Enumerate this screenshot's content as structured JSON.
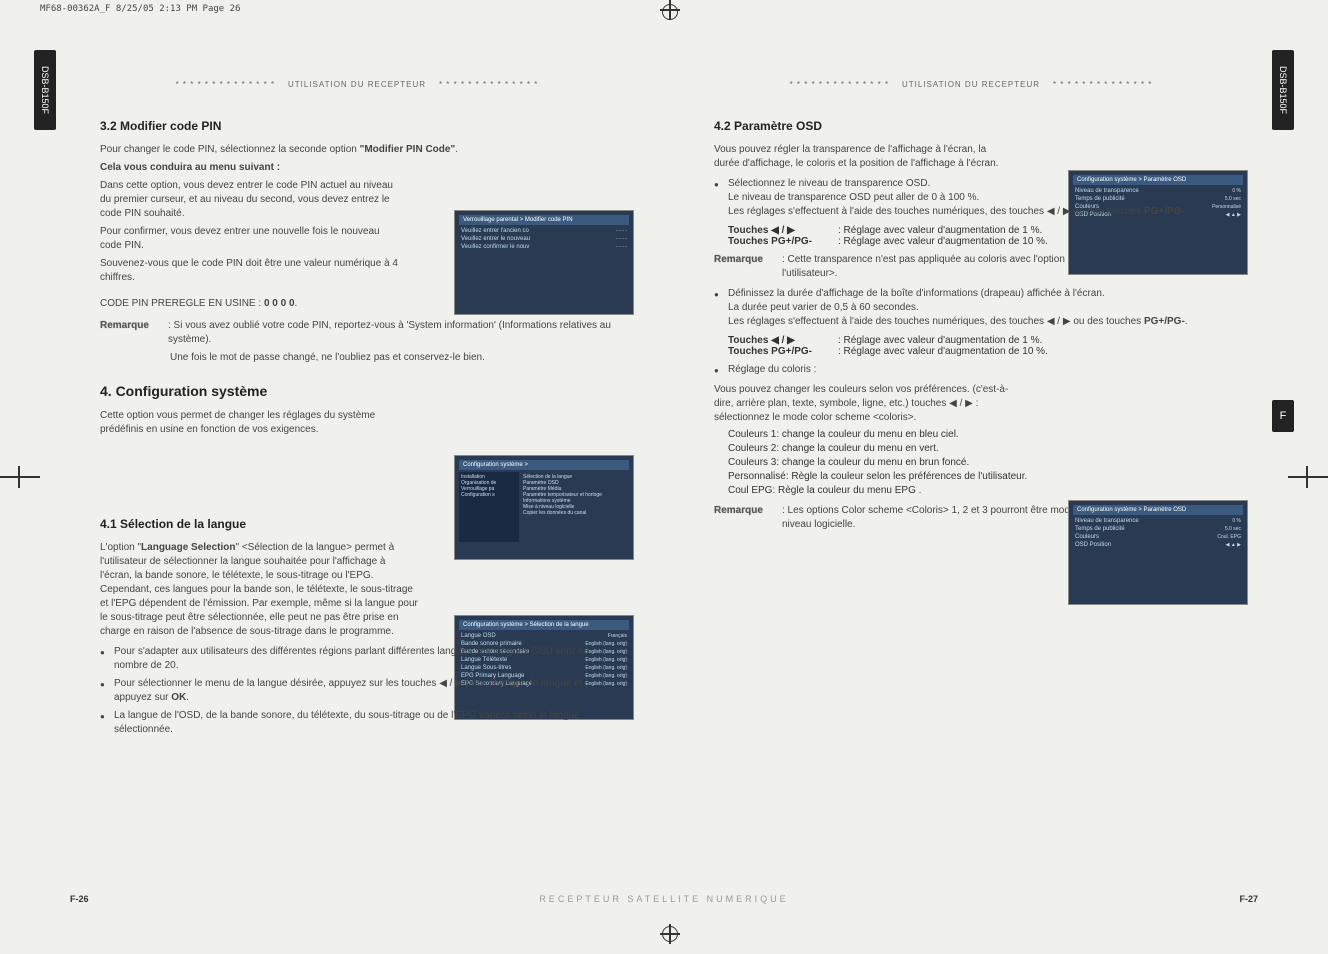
{
  "top_header": "MF68-00362A_F  8/25/05  2:13 PM  Page 26",
  "side_model": "DSB-B150F",
  "side_f": "F",
  "receiver_header_dots": "* * * * * * * * * * * * * *",
  "receiver_header_text": "UTILISATION DU RECEPTEUR",
  "left": {
    "h32": "3.2 Modifier code PIN",
    "p32_1": "Pour changer le code PIN, sélectionnez la seconde option ",
    "p32_1b": "\"Modifier PIN Code\"",
    "p32_1c": ".",
    "p32_sub": "Cela vous conduira au menu suivant :",
    "p32_2": "Dans cette option, vous devez entrer le code PIN actuel au niveau du premier curseur, et au niveau du second, vous devez entrez le code PIN souhaité.",
    "p32_3": "Pour confirmer, vous devez entrer une nouvelle fois le nouveau code PIN.",
    "p32_4": "Souvenez-vous que le code PIN doit être une valeur numérique à 4 chiffres.",
    "p32_5a": "CODE PIN PREREGLE EN USINE : ",
    "p32_5b": "0 0 0 0",
    "p32_5c": ".",
    "note_label": "Remarque",
    "note32_1": ": Si vous avez oublié votre code PIN, reportez-vous à 'System information' (Informations relatives au système).",
    "note32_2": "Une fois le mot de passe changé, ne l'oubliez pas et conservez-le bien.",
    "h4": "4. Configuration système",
    "p4_1": "Cette option vous permet de changer les réglages du système prédéfinis en usine en fonction de vos exigences.",
    "h41": "4.1 Sélection de la langue",
    "p41_1a": "L'option \"",
    "p41_1b": "Language Selection",
    "p41_1c": "\" <Sélection de la langue> permet à l'utilisateur de sélectionner la langue souhaitée pour l'affichage à l'écran, la bande sonore, le télétexte, le sous-titrage ou l'EPG. Cependant, ces langues pour la bande son, le télétexte, le sous-titrage et l'EPG dépendent de l'émission. Par exemple, même si la langue pour le sous-titrage peut être sélectionnée, elle peut ne pas être prise en charge en raison de l'absence de sous-titrage dans le programme.",
    "b41_1": "Pour s'adapter aux utilisateurs des différentes régions parlant différentes langues, les langues OSD sont au nombre de 20.",
    "b41_2a": "Pour sélectionner le menu de la langue désirée, appuyez sur les touches ◀ / ▶ pour changer de langue et appuyez sur ",
    "b41_2b": "OK",
    "b41_2c": ".",
    "b41_3": "La langue de l'OSD, de la bande sonore, du télétexte, du sous-titrage ou de l'EPG variera selon la langue sélectionnée.",
    "pn": "F-26"
  },
  "right": {
    "h42": "4.2 Paramètre OSD",
    "p42_1": "Vous pouvez régler la transparence de l'affichage à l'écran, la durée d'affichage, le coloris et la position de l'affichage à l'écran.",
    "b42_1a": "Sélectionnez le niveau de transparence OSD.",
    "b42_1b": "Le niveau de transparence OSD peut aller de 0 à 100 %.",
    "b42_1c": "Les réglages s'effectuent à l'aide des touches numériques, des touches ◀ / ▶ ou des touches ",
    "b42_1d": "PG+/PG-",
    "b42_1e": ".",
    "t_k1": "Touches ◀ / ▶",
    "t_v1": ": Réglage avec valeur d'augmentation de 1 %.",
    "t_k2": "Touches PG+/PG-",
    "t_v2": ": Réglage avec valeur d'augmentation de 10 %.",
    "note42_1": ": Cette transparence n'est pas appliquée au coloris avec l'option \"User Defined\" <Défini par l'utilisateur>.",
    "b42_2a": "Définissez la durée d'affichage de la boîte d'informations (drapeau) affichée à l'écran.",
    "b42_2b": "La durée peut varier de 0,5 à 60 secondes.",
    "b42_2c": "Les réglages s'effectuent à l'aide des touches numériques, des touches ◀ / ▶ ou des touches ",
    "b42_2d": "PG+/PG-",
    "b42_2e": ".",
    "b42_3": "Réglage du coloris :",
    "p42_col": "Vous pouvez changer les couleurs selon vos préférences. (c'est-à-dire, arrière plan, texte, symbole, ligne, etc.) touches ◀ / ▶ : sélectionnez le mode color scheme <coloris>.",
    "col1": "Couleurs 1: change la couleur du menu en bleu ciel.",
    "col2": "Couleurs 2: change la couleur du menu en vert.",
    "col3": "Couleurs 3: change la couleur du menu en brun foncé.",
    "col4": "Personnalisé: Règle la couleur selon les préférences de l'utilisateur.",
    "col5": "Coul EPG: Règle la couleur du menu EPG .",
    "note42_2": ": Les options Color scheme <Coloris> 1, 2 et 3 pourront être modifiées à l'avenir par une mise à niveau logicielle.",
    "pn": "F-27"
  },
  "mid_footer": "RECEPTEUR   SATELLITE   NUMERIQUE",
  "screenshots": {
    "pin": {
      "title": "Verrouillage parental > Modifier code PIN",
      "r1": "Veuillez entrer l'ancien co",
      "r2": "Veuillez entrer le nouveau",
      "r3": "Veuillez confirmer le nouv"
    },
    "sys": {
      "title": "Configuration système >",
      "m1": "Installation",
      "m2": "Organisation de",
      "m3": "Verrouillage pa",
      "m4": "Configuration s",
      "r1": "Sélection de la langue",
      "r2": "Paramètre OSD",
      "r3": "Paramètre Média",
      "r4": "Paramètre temporisateur et horloge",
      "r5": "Informations système",
      "r6": "Mise à niveau logicielle",
      "r7": "Copier les données du canal"
    },
    "lang": {
      "title": "Configuration système > Sélection de la langue",
      "r1": "Langue OSD",
      "r2": "Bande sonore primaire",
      "r3": "Bande sonore secondaire",
      "r4": "Langue Télétexte",
      "r5": "Langue Sous-titres",
      "r6": "EPG Primary Language",
      "r7": "EPG Secondary Language",
      "v": "Français",
      "v2": "English   (lang. orig)"
    },
    "osd1": {
      "title": "Configuration système > Paramètre OSD",
      "r1": "Niveau de transparence",
      "r2": "Temps de publicité",
      "r3": "Couleurs",
      "r4": "OSD Position",
      "v1": "0 %",
      "v2": "5.0  sec",
      "v3": "Personnalisé"
    },
    "osd2": {
      "title": "Configuration système > Paramètre OSD",
      "r1": "Niveau de transparence",
      "r2": "Temps de publicité",
      "r3": "Couleurs",
      "r4": "OSD Position",
      "v1": "0 %",
      "v2": "5.0  sec",
      "v3": "Coul. EPG"
    }
  }
}
